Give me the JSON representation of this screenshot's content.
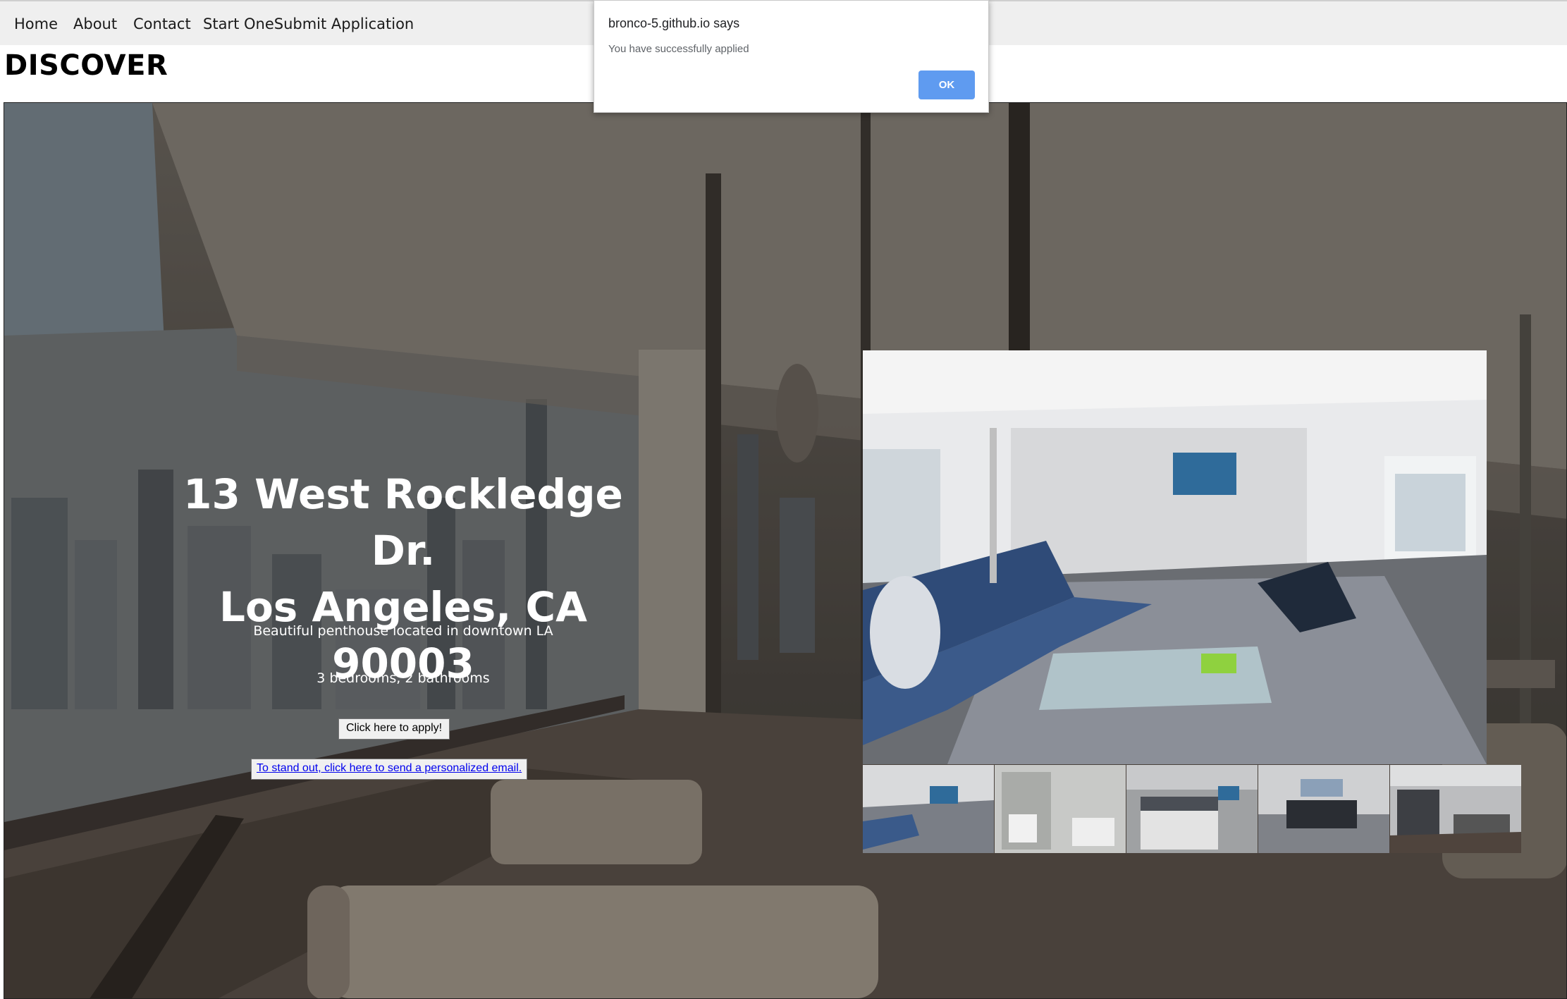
{
  "nav": {
    "items": [
      "Home",
      "About",
      "Contact",
      "Start OneSubmit Application"
    ]
  },
  "brand": "DISCOVER",
  "listing": {
    "address_line1": "13 West Rockledge Dr.",
    "address_line2": "Los Angeles, CA 90003",
    "description": "Beautiful penthouse located in downtown LA",
    "rooms": "3 bedrooms, 2 bathrooms",
    "apply_label": "Click here to apply!",
    "email_label": "To stand out, click here to send a personalized email."
  },
  "gallery": {
    "thumbnails": [
      "living-room",
      "bathroom",
      "bedroom",
      "kitchen",
      "office"
    ]
  },
  "alert": {
    "title": "bronco-5.github.io says",
    "message": "You have successfully applied",
    "ok_label": "OK"
  },
  "colors": {
    "nav_bg": "#efefef",
    "ok_button": "#5f9bf0",
    "link": "#0000ee"
  }
}
